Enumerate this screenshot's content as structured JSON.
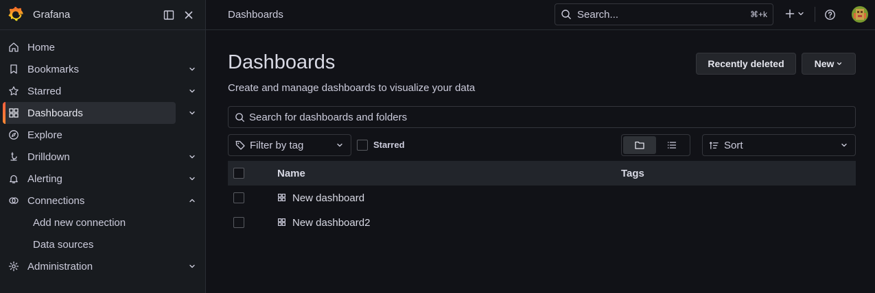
{
  "app": {
    "brand": "Grafana"
  },
  "sidebar": {
    "items": [
      {
        "label": "Home",
        "icon": "home-icon"
      },
      {
        "label": "Bookmarks",
        "icon": "bookmark-icon"
      },
      {
        "label": "Starred",
        "icon": "star-icon"
      },
      {
        "label": "Dashboards",
        "icon": "apps-icon",
        "active": true
      },
      {
        "label": "Explore",
        "icon": "compass-icon"
      },
      {
        "label": "Drilldown",
        "icon": "drilldown-icon"
      },
      {
        "label": "Alerting",
        "icon": "bell-icon"
      },
      {
        "label": "Connections",
        "icon": "link-icon",
        "expanded": true
      },
      {
        "label": "Add new connection"
      },
      {
        "label": "Data sources"
      },
      {
        "label": "Administration",
        "icon": "cog-icon"
      }
    ]
  },
  "topbar": {
    "breadcrumb": "Dashboards",
    "search_placeholder": "Search...",
    "search_shortcut": "⌘+k"
  },
  "page": {
    "title": "Dashboards",
    "subtitle": "Create and manage dashboards to visualize your data",
    "recently_deleted_label": "Recently deleted",
    "new_label": "New",
    "search_placeholder": "Search for dashboards and folders",
    "filter_tag_placeholder": "Filter by tag",
    "starred_label": "Starred",
    "sort_label": "Sort"
  },
  "table": {
    "columns": [
      "Name",
      "Tags"
    ],
    "rows": [
      {
        "name": "New dashboard",
        "tags": ""
      },
      {
        "name": "New dashboard2",
        "tags": ""
      }
    ]
  },
  "colors": {
    "background": "#111217",
    "sidebar": "#181b1f",
    "accent_gradient": [
      "#f55f3e",
      "#ff8833"
    ]
  }
}
